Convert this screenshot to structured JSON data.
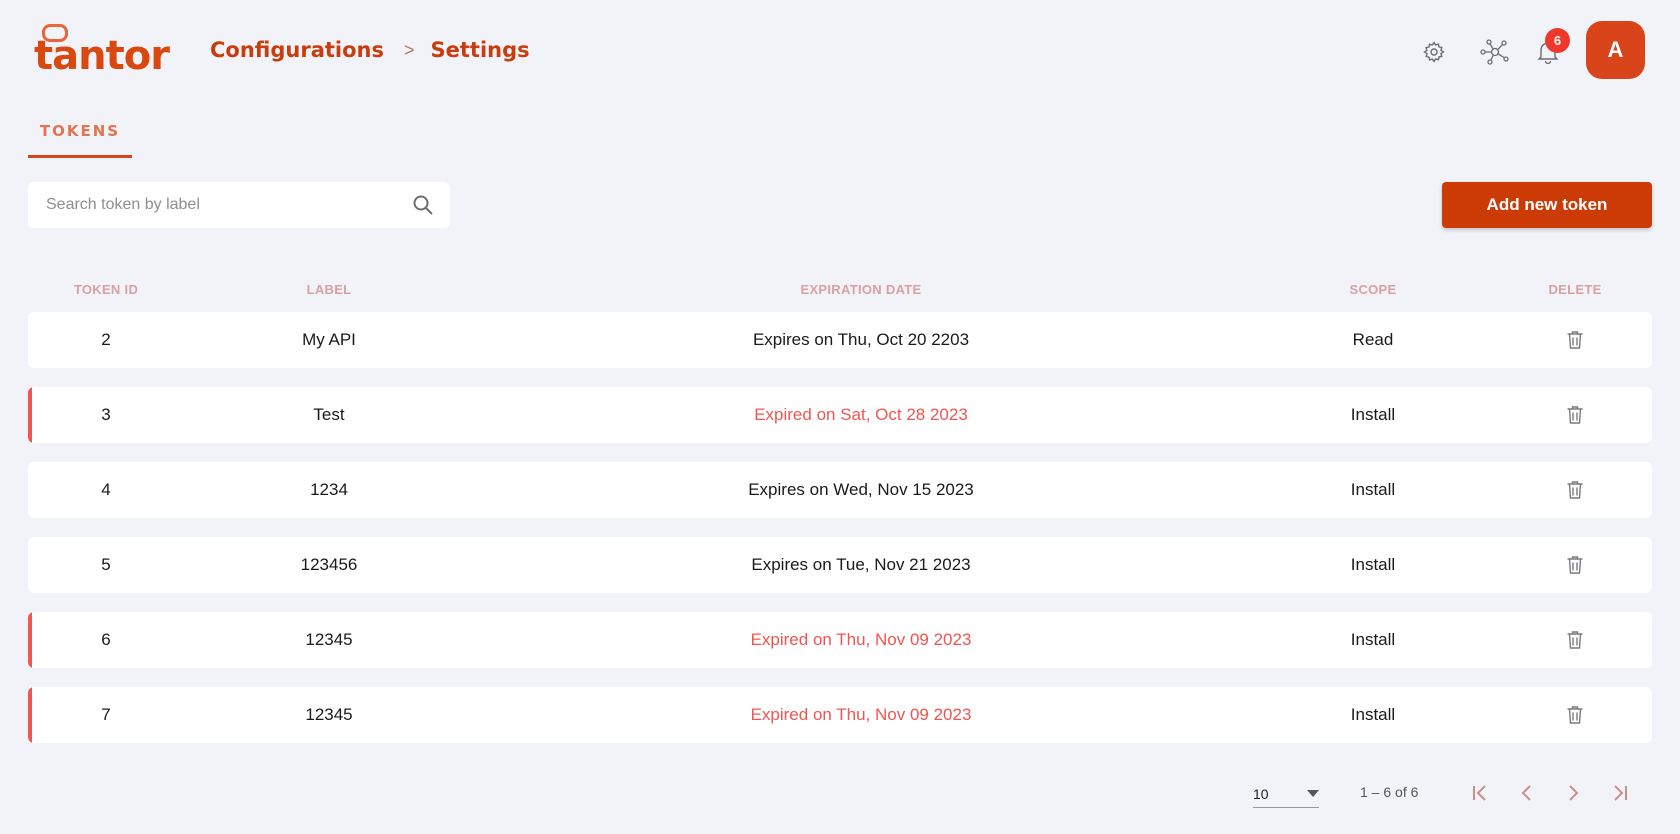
{
  "brand": {
    "logo_text": "tantor",
    "accent": "#cc3a06",
    "expired_color": "#f05550"
  },
  "breadcrumb": {
    "items": [
      "Configurations",
      "Settings"
    ],
    "separator": ">"
  },
  "header": {
    "notification_count": "6",
    "avatar_initial": "A",
    "icons": [
      "gear-icon",
      "network-icon",
      "bell-icon"
    ]
  },
  "tabs": [
    {
      "label": "TOKENS",
      "active": true
    }
  ],
  "search": {
    "placeholder": "Search token by label",
    "value": ""
  },
  "actions": {
    "add_label": "Add new token"
  },
  "table": {
    "columns": [
      "TOKEN ID",
      "LABEL",
      "EXPIRATION DATE",
      "SCOPE",
      "DELETE"
    ],
    "rows": [
      {
        "id": "2",
        "label": "My API",
        "expiration": "Expires on Thu, Oct 20 2203",
        "expired": false,
        "scope": "Read"
      },
      {
        "id": "3",
        "label": "Test",
        "expiration": "Expired on Sat, Oct 28 2023",
        "expired": true,
        "scope": "Install"
      },
      {
        "id": "4",
        "label": "1234",
        "expiration": "Expires on Wed, Nov 15 2023",
        "expired": false,
        "scope": "Install"
      },
      {
        "id": "5",
        "label": "123456",
        "expiration": "Expires on Tue, Nov 21 2023",
        "expired": false,
        "scope": "Install"
      },
      {
        "id": "6",
        "label": "12345",
        "expiration": "Expired on Thu, Nov 09 2023",
        "expired": true,
        "scope": "Install"
      },
      {
        "id": "7",
        "label": "12345",
        "expiration": "Expired on Thu, Nov 09 2023",
        "expired": true,
        "scope": "Install"
      }
    ]
  },
  "pagination": {
    "page_size": "10",
    "range": "1 – 6 of 6"
  }
}
